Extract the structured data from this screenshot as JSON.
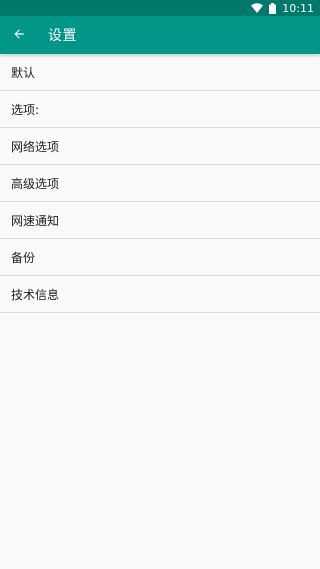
{
  "status_bar": {
    "time": "10:11"
  },
  "app_bar": {
    "title": "设置"
  },
  "settings": {
    "items": [
      {
        "label": "默认"
      },
      {
        "label": "选项:"
      },
      {
        "label": "网络选项"
      },
      {
        "label": "高级选项"
      },
      {
        "label": "网速通知"
      },
      {
        "label": "备份"
      },
      {
        "label": "技术信息"
      }
    ]
  }
}
